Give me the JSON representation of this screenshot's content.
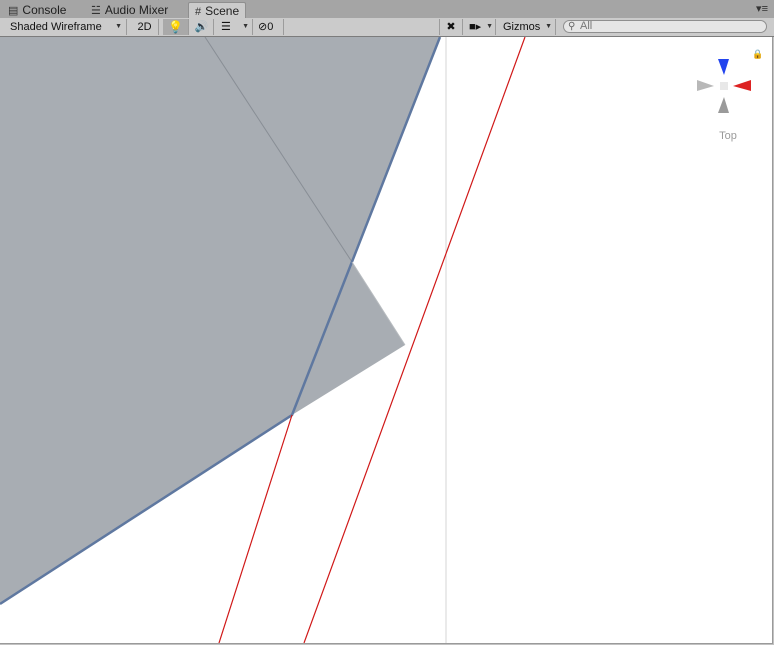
{
  "tabs": [
    {
      "label": "Console",
      "icon": "console-icon",
      "active": false
    },
    {
      "label": "Audio Mixer",
      "icon": "audio-mixer-icon",
      "active": false
    },
    {
      "label": "Scene",
      "icon": "scene-grid-icon",
      "active": true
    }
  ],
  "toolbar": {
    "draw_mode": "Shaded Wireframe",
    "mode_2d": "2D",
    "hidden_count": "0",
    "gizmos": "Gizmos",
    "search_placeholder": "All"
  },
  "scene_gizmo": {
    "view_label": "Top"
  },
  "colors": {
    "mesh_fill": "#a8adb3",
    "mesh_edge": "#5f78a0",
    "red_line": "#d01818",
    "axis_x": "#dd2222",
    "axis_z": "#2244ee",
    "axis_y": "#9a9a9a"
  }
}
